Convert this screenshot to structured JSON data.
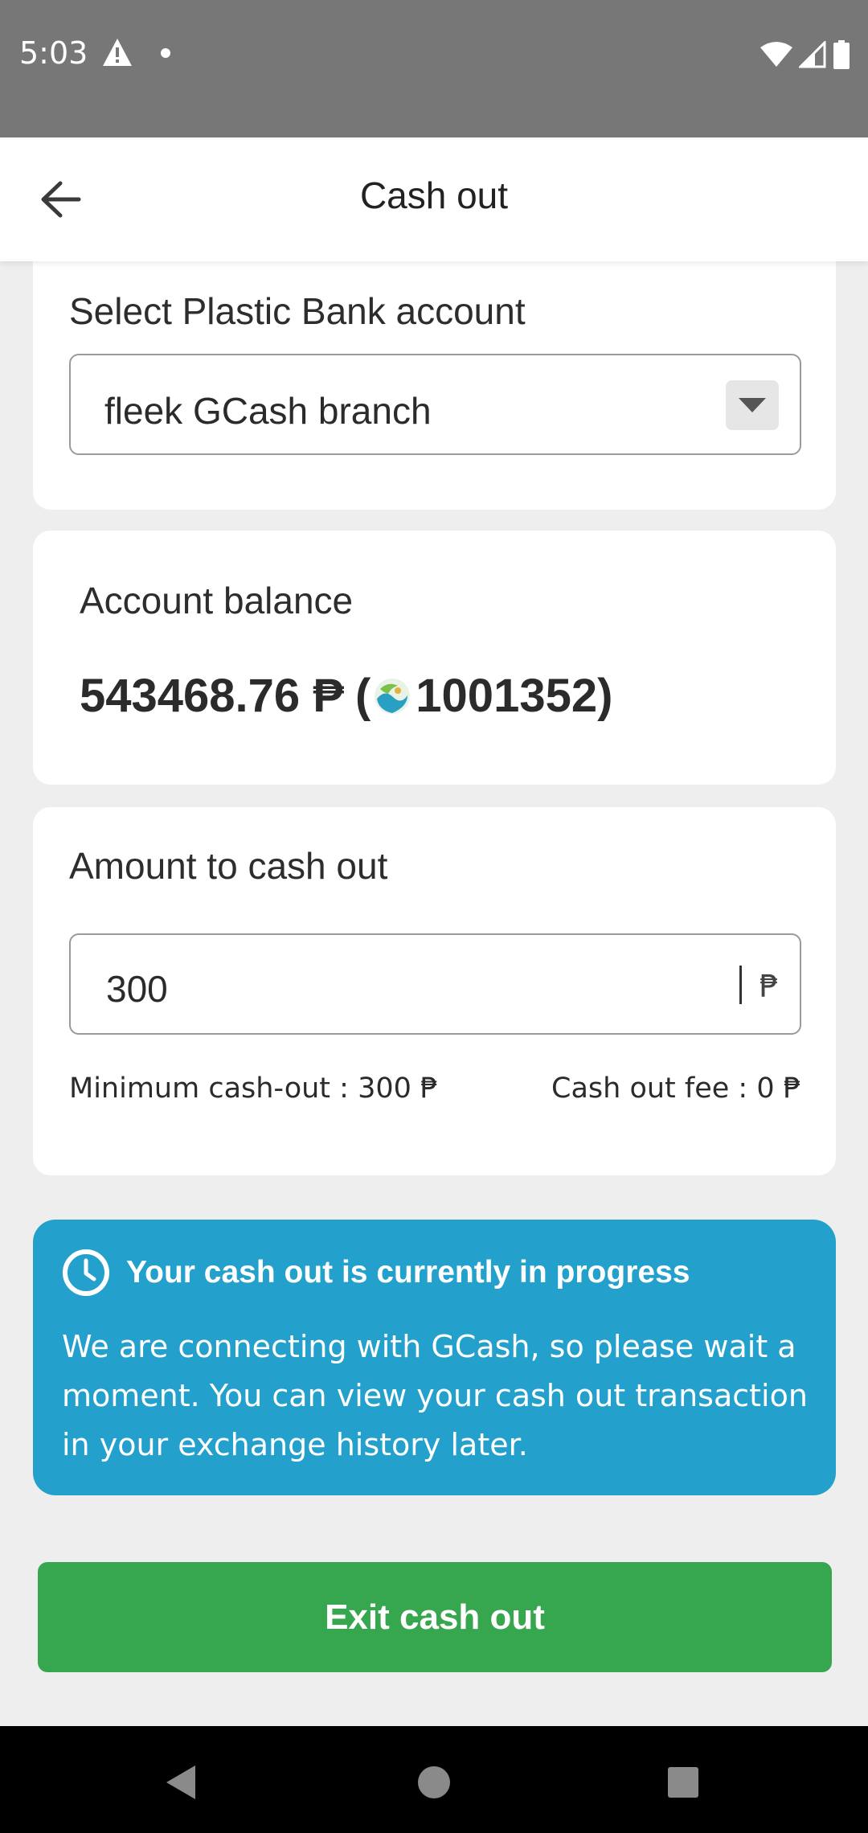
{
  "status_bar": {
    "time": "5:03",
    "icons": [
      "warning-icon",
      "notification-dot",
      "wifi-icon",
      "signal-icon",
      "battery-icon"
    ]
  },
  "app_bar": {
    "title": "Cash out",
    "back_icon": "arrow-left-icon"
  },
  "account_section": {
    "label": "Select Plastic Bank account",
    "selected_account": "fleek GCash branch"
  },
  "balance_section": {
    "label": "Account balance",
    "amount": "543468.76 ₱",
    "open_paren": "(",
    "points": "1001352)"
  },
  "amount_section": {
    "label": "Amount to cash out",
    "value": "300",
    "currency": "₱",
    "minimum": "Minimum cash-out : 300 ₱",
    "fee": "Cash out fee : 0 ₱"
  },
  "banner": {
    "title": "Your cash out is currently in progress",
    "body": "We are connecting with GCash, so please wait a moment. You can view your cash out transaction in your exchange history later.",
    "color": "#23a0cb"
  },
  "exit_button": {
    "label": "Exit cash out",
    "color": "#37a74f"
  },
  "nav_bar": {
    "icons": [
      "back-triangle-icon",
      "home-circle-icon",
      "recents-square-icon"
    ]
  }
}
